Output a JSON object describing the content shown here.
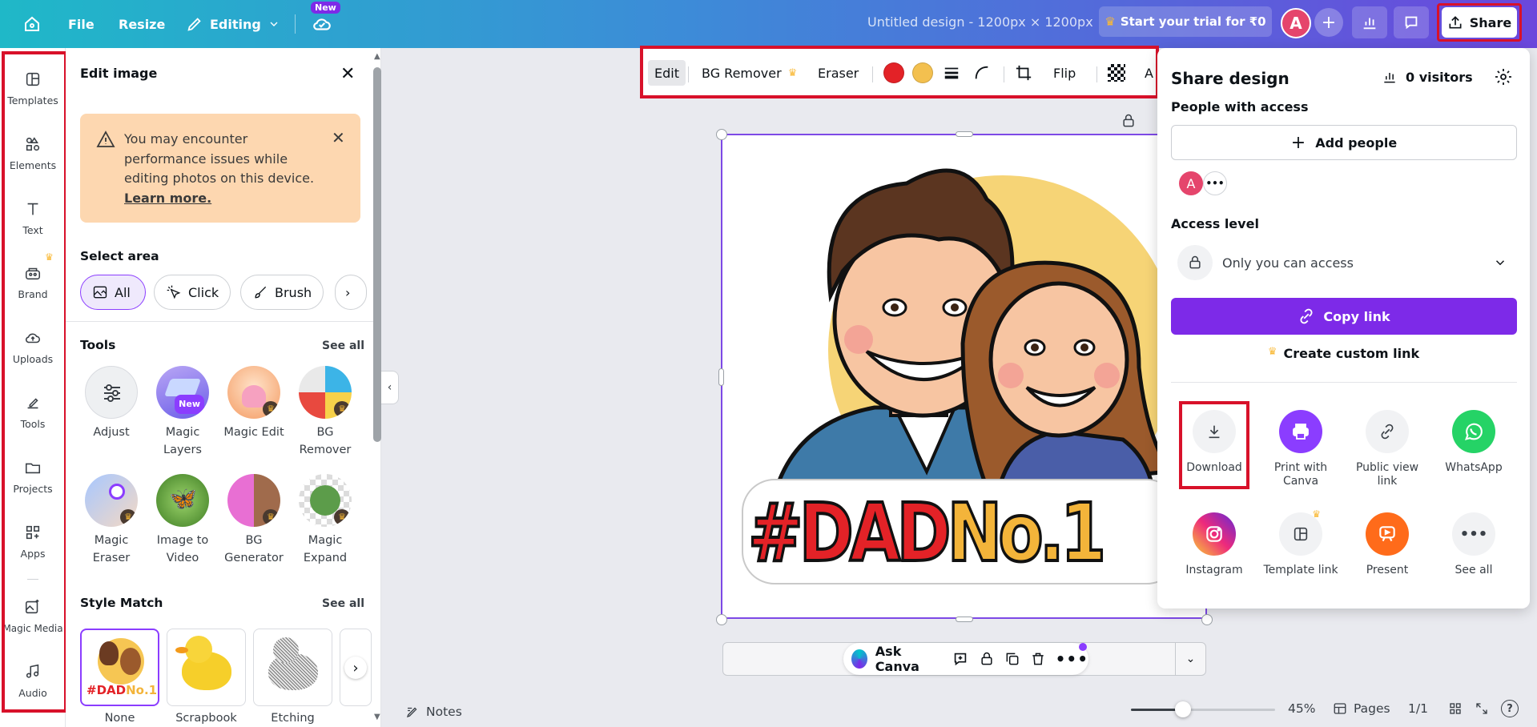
{
  "topbar": {
    "file": "File",
    "resize": "Resize",
    "editing": "Editing",
    "new_badge": "New",
    "design_title": "Untitled design - 1200px × 1200px",
    "trial": "Start your trial for ₹0",
    "avatar_letter": "A",
    "share": "Share"
  },
  "rail": [
    {
      "label": "Templates",
      "icon": "templates-icon"
    },
    {
      "label": "Elements",
      "icon": "elements-icon"
    },
    {
      "label": "Text",
      "icon": "text-icon"
    },
    {
      "label": "Brand",
      "icon": "brand-icon"
    },
    {
      "label": "Uploads",
      "icon": "uploads-icon"
    },
    {
      "label": "Tools",
      "icon": "tools-icon"
    },
    {
      "label": "Projects",
      "icon": "projects-icon"
    },
    {
      "label": "Apps",
      "icon": "apps-icon"
    },
    {
      "label": "Magic Media",
      "icon": "magic-media-icon"
    },
    {
      "label": "Audio",
      "icon": "audio-icon"
    }
  ],
  "panel": {
    "title": "Edit image",
    "warning_text": "You may encounter performance issues while editing photos on this device.",
    "warning_link": "Learn more.",
    "select_area_heading": "Select area",
    "select_chips": [
      "All",
      "Click",
      "Brush"
    ],
    "tools_heading": "Tools",
    "see_all": "See all",
    "tools": [
      {
        "label": "Adjust"
      },
      {
        "label": "Magic Layers",
        "badge": "New"
      },
      {
        "label": "Magic Edit"
      },
      {
        "label": "BG Remover"
      },
      {
        "label": "Magic Eraser"
      },
      {
        "label": "Image to Video"
      },
      {
        "label": "BG Generator"
      },
      {
        "label": "Magic Expand"
      }
    ],
    "style_heading": "Style Match",
    "styles": [
      "None",
      "Scrapbook",
      "Etching"
    ]
  },
  "context_toolbar": {
    "edit": "Edit",
    "bg_remover": "BG Remover",
    "eraser": "Eraser",
    "flip": "Flip",
    "colors": [
      "#e32227",
      "#f3c04f"
    ],
    "cut_letter": "A"
  },
  "canvas": {
    "sticker_text_part1": "#DAD",
    "sticker_text_part2": "No.1"
  },
  "bottom": {
    "ask_canva": "Ask Canva",
    "notes": "Notes",
    "zoom": "45%",
    "pages": "Pages",
    "page_count": "1/1",
    "zoom_level": 0.45
  },
  "share_panel": {
    "title": "Share design",
    "visitors": "0 visitors",
    "people_with_access": "People with access",
    "add_people": "Add people",
    "member_letter": "A",
    "access_level": "Access level",
    "access_value": "Only you can access",
    "copy_link": "Copy link",
    "custom_link": "Create custom link",
    "options": [
      {
        "label": "Download",
        "icon": "download-icon"
      },
      {
        "label": "Print with Canva",
        "icon": "print-icon"
      },
      {
        "label": "Public view link",
        "icon": "link-icon"
      },
      {
        "label": "WhatsApp",
        "icon": "whatsapp-icon"
      },
      {
        "label": "Instagram",
        "icon": "instagram-icon"
      },
      {
        "label": "Template link",
        "icon": "template-link-icon"
      },
      {
        "label": "Present",
        "icon": "present-icon"
      },
      {
        "label": "See all",
        "icon": "more-icon"
      }
    ]
  },
  "colors": {
    "accent": "#7d2ae8",
    "highlight": "#d8112a",
    "warning_bg": "#fdd7b0"
  }
}
